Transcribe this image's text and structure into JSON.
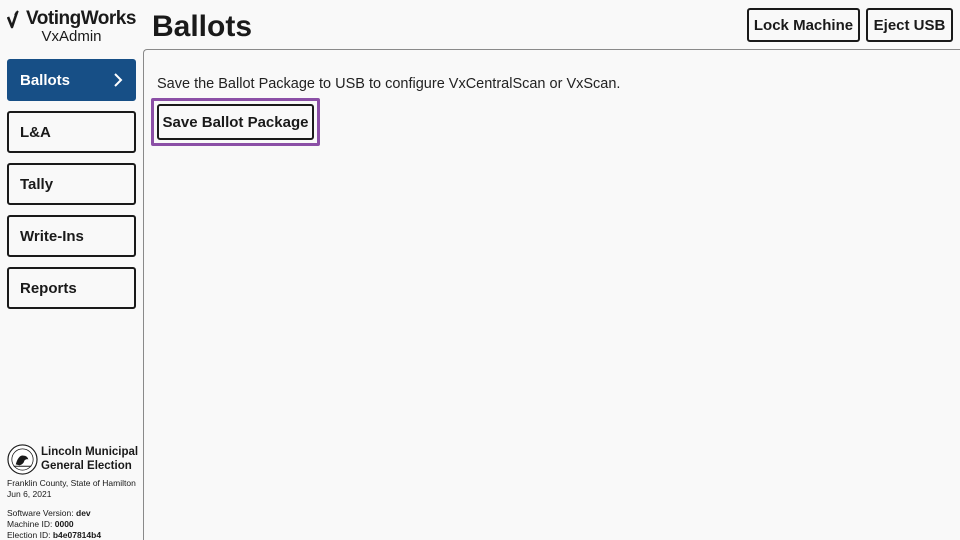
{
  "brand": {
    "name": "VotingWorks",
    "product": "VxAdmin"
  },
  "page": {
    "title": "Ballots"
  },
  "header": {
    "lock_label": "Lock Machine",
    "eject_label": "Eject USB"
  },
  "sidebar": {
    "items": [
      {
        "label": "Ballots",
        "active": true
      },
      {
        "label": "L&A",
        "active": false
      },
      {
        "label": "Tally",
        "active": false
      },
      {
        "label": "Write-Ins",
        "active": false
      },
      {
        "label": "Reports",
        "active": false
      }
    ]
  },
  "main": {
    "instruction": "Save the Ballot Package to USB to configure VxCentralScan or VxScan.",
    "save_label": "Save Ballot Package"
  },
  "election": {
    "title_line1": "Lincoln Municipal",
    "title_line2": "General Election",
    "county_state": "Franklin County, State of Hamilton",
    "date": "Jun 6, 2021"
  },
  "machine": {
    "software_label": "Software Version:",
    "software_value": "dev",
    "machine_label": "Machine ID:",
    "machine_value": "0000",
    "election_label": "Election ID:",
    "election_value": "b4e07814b4"
  },
  "colors": {
    "active_nav": "#174f86",
    "focus_ring": "#8b4fa6",
    "background": "#f9f9f9",
    "text": "#1a1a1a"
  },
  "icons": {
    "brand": "votingworks-checkmark-logo",
    "nav_active": "chevron-right-icon",
    "seal": "state-seal-icon"
  }
}
